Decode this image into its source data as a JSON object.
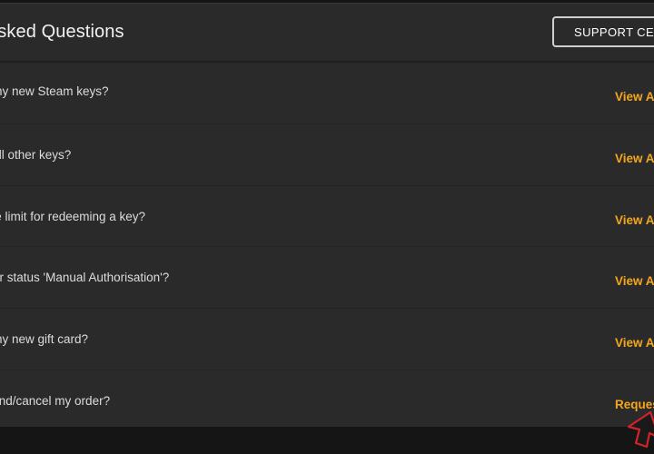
{
  "faq": {
    "title": "tly Asked Questions",
    "support_button_label": "SUPPORT CEN",
    "items": [
      {
        "question": "e my new Steam keys?",
        "action": "View A"
      },
      {
        "question": "e all other keys?",
        "action": "View A"
      },
      {
        "question": "ime limit for redeeming a key?",
        "action": "View A"
      },
      {
        "question": "rder status 'Manual Authorisation'?",
        "action": "View A"
      },
      {
        "question": "e my new gift card?",
        "action": "View A"
      },
      {
        "question": "efund/cancel my order?",
        "action": "Reques"
      }
    ]
  },
  "colors": {
    "accent": "#f4a71d",
    "panel": "#2a2a2a",
    "text": "#dcdcdc",
    "cursor_outline": "#d2232a"
  },
  "icons": {
    "cursor": "cursor-arrow-icon"
  }
}
